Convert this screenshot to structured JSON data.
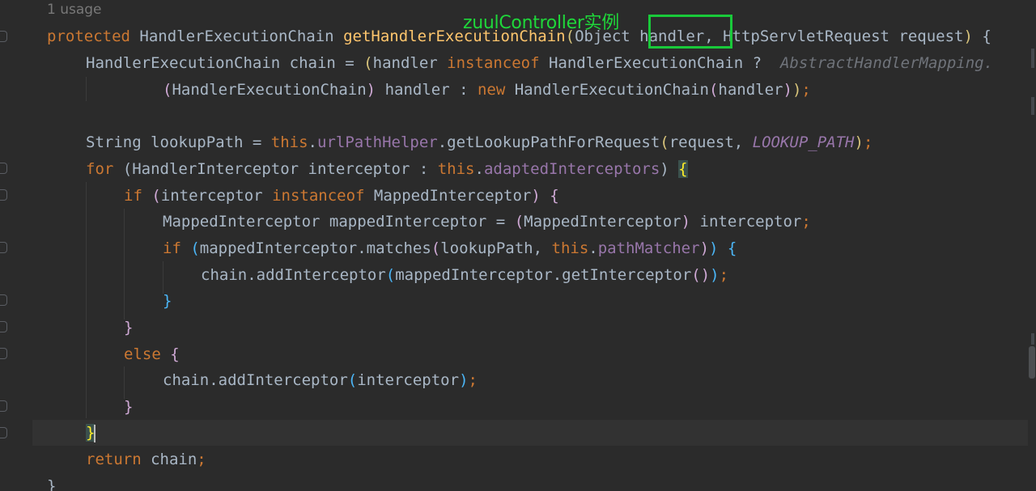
{
  "usage_hint": "1 usage",
  "annotation": {
    "label": "zuulController实例",
    "color": "#1fd73a"
  },
  "code": {
    "l1": {
      "kw_protected": "protected",
      "ret_type": " HandlerExecutionChain ",
      "method_name": "getHandlerExecutionChain",
      "open": "(",
      "params": "Object handler, HttpServletRequest request",
      "close": ")",
      "brace": " {"
    },
    "l2": {
      "decl": "HandlerExecutionChain chain = ",
      "open": "(",
      "handler": "handler ",
      "kw_instanceof": "instanceof",
      "type": " HandlerExecutionChain ?  ",
      "hint": "AbstractHandlerMapping."
    },
    "l3": {
      "open": "(",
      "cast_type": "HandlerExecutionChain",
      "close": ")",
      "mid": " handler : ",
      "kw_new": "new",
      "ctor": " HandlerExecutionChain",
      "arg_open": "(",
      "arg": "handler",
      "arg_close": ")",
      "outer_close": ")",
      "semi": ";"
    },
    "l4": {
      "decl": "String lookupPath = ",
      "kw_this": "this",
      "dot": ".",
      "field": "urlPathHelper",
      "call": ".getLookupPathForRequest",
      "open": "(",
      "arg1": "request, ",
      "const": "LOOKUP_PATH",
      "close": ")",
      "semi": ";"
    },
    "l5": {
      "kw_for": "for",
      "open": " (",
      "var": "HandlerInterceptor interceptor : ",
      "kw_this": "this",
      "dot": ".",
      "field": "adaptedInterceptors",
      "close": ") ",
      "brace": "{"
    },
    "l6": {
      "kw_if": "if",
      "open": " (",
      "var": "interceptor ",
      "kw_instanceof": "instanceof",
      "type": " MappedInterceptor",
      "close": ")",
      "brace": " {"
    },
    "l7": {
      "decl": "MappedInterceptor mappedInterceptor = ",
      "open": "(",
      "cast": "MappedInterceptor",
      "close": ")",
      "rest": " interceptor",
      "semi": ";"
    },
    "l8": {
      "kw_if": "if",
      "open": " (",
      "call": "mappedInterceptor.matches",
      "inner_open": "(",
      "arg1": "lookupPath, ",
      "kw_this": "this",
      "dot": ".",
      "field": "pathMatcher",
      "inner_close": ")",
      "close": ")",
      "brace": " {"
    },
    "l9": {
      "call": "chain.addInterceptor",
      "open": "(",
      "arg": "mappedInterceptor.getInterceptor",
      "inner": "()",
      "close": ")",
      "semi": ";"
    },
    "l10": {
      "brace": "}"
    },
    "l11": {
      "brace": "}"
    },
    "l12": {
      "kw_else": "else",
      "brace": " {"
    },
    "l13": {
      "call": "chain.addInterceptor",
      "open": "(",
      "arg": "interceptor",
      "close": ")",
      "semi": ";"
    },
    "l14": {
      "brace": "}"
    },
    "l15": {
      "brace": "}"
    },
    "l16": {
      "kw_return": "return",
      "rest": " chain",
      "semi": ";"
    },
    "l17": {
      "brace": "}"
    }
  }
}
